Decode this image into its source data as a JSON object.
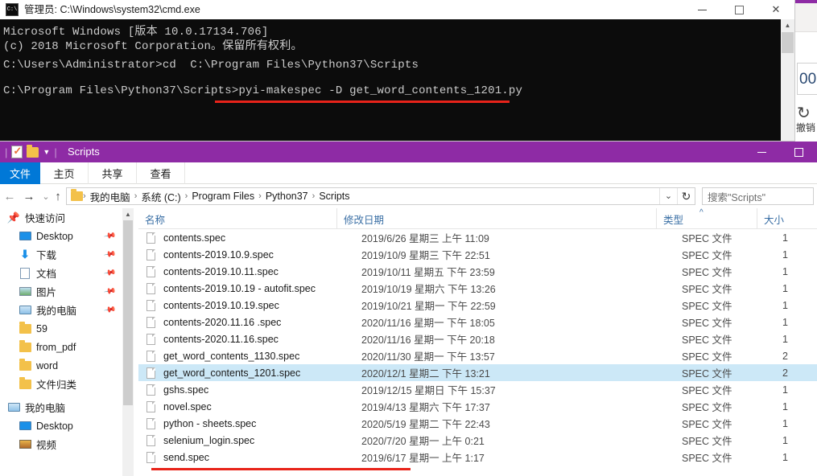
{
  "background_app": {
    "cell_value": "00",
    "undo_label": "撤销",
    "undo_icon": "undo-arrow-icon"
  },
  "cmd_window": {
    "icon": "console-icon",
    "title": "管理员: C:\\Windows\\system32\\cmd.exe",
    "buttons": {
      "minimize": "minimize-icon",
      "maximize": "maximize-icon",
      "close": "✕"
    },
    "lines": [
      "Microsoft Windows [版本 10.0.17134.706]",
      "(c) 2018 Microsoft Corporation。保留所有权利。",
      "",
      "C:\\Users\\Administrator>cd  C:\\Program Files\\Python37\\Scripts",
      "",
      "C:\\Program Files\\Python37\\Scripts>pyi-makespec -D get_word_contents_1201.py"
    ],
    "highlight_color": "#e8231a"
  },
  "explorer": {
    "accent_color": "#8e2ba5",
    "title": "Scripts",
    "quick_access_toolbar": [
      {
        "name": "properties-icon"
      },
      {
        "name": "new-folder-icon"
      },
      {
        "name": "customize-qat-caret-icon"
      }
    ],
    "window_buttons": {
      "minimize": "minimize-icon",
      "maximize": "maximize-icon"
    },
    "ribbon": {
      "file_tab": "文件",
      "tabs": [
        {
          "label": "主页"
        },
        {
          "label": "共享"
        },
        {
          "label": "查看"
        }
      ]
    },
    "navigation": {
      "back_icon": "back-arrow-icon",
      "forward_icon": "forward-arrow-icon",
      "recent_icon": "recent-locations-chevron-icon",
      "up_icon": "up-arrow-icon",
      "breadcrumbs": [
        "我的电脑",
        "系统 (C:)",
        "Program Files",
        "Python37",
        "Scripts"
      ],
      "dropdown_icon": "chevron-down-icon",
      "refresh_icon": "refresh-icon"
    },
    "search": {
      "placeholder": "搜索\"Scripts\"",
      "value": ""
    },
    "sidebar": {
      "groups": [
        {
          "header": {
            "label": "快速访问",
            "icon": "pin-star-icon"
          },
          "items": [
            {
              "label": "Desktop",
              "icon": "monitor-icon",
              "pinned": true
            },
            {
              "label": "下载",
              "icon": "download-arrow-icon",
              "pinned": true
            },
            {
              "label": "文档",
              "icon": "document-icon",
              "pinned": true
            },
            {
              "label": "图片",
              "icon": "picture-icon",
              "pinned": true
            },
            {
              "label": "我的电脑",
              "icon": "computer-icon",
              "pinned": true
            },
            {
              "label": "59",
              "icon": "folder-icon",
              "pinned": false
            },
            {
              "label": "from_pdf",
              "icon": "folder-icon",
              "pinned": false
            },
            {
              "label": "word",
              "icon": "folder-icon",
              "pinned": false
            },
            {
              "label": "文件归类",
              "icon": "folder-icon",
              "pinned": false
            }
          ]
        },
        {
          "header": {
            "label": "我的电脑",
            "icon": "computer-icon"
          },
          "items": [
            {
              "label": "Desktop",
              "icon": "monitor-icon",
              "pinned": false
            },
            {
              "label": "视频",
              "icon": "video-icon",
              "pinned": false
            }
          ]
        }
      ]
    },
    "filelist": {
      "columns": [
        {
          "label": "名称",
          "sorted": false
        },
        {
          "label": "修改日期",
          "sorted": false
        },
        {
          "label": "类型",
          "sorted": true,
          "sort_indicator": "^"
        },
        {
          "label": "大小",
          "sorted": false
        }
      ],
      "rows": [
        {
          "name": "contents.spec",
          "date": "2019/6/26 星期三 上午 11:09",
          "type": "SPEC 文件",
          "size": "1",
          "selected": false
        },
        {
          "name": "contents-2019.10.9.spec",
          "date": "2019/10/9 星期三 下午 22:51",
          "type": "SPEC 文件",
          "size": "1",
          "selected": false
        },
        {
          "name": "contents-2019.10.11.spec",
          "date": "2019/10/11 星期五 下午 23:59",
          "type": "SPEC 文件",
          "size": "1",
          "selected": false
        },
        {
          "name": "contents-2019.10.19 - autofit.spec",
          "date": "2019/10/19 星期六 下午 13:26",
          "type": "SPEC 文件",
          "size": "1",
          "selected": false
        },
        {
          "name": "contents-2019.10.19.spec",
          "date": "2019/10/21 星期一 下午 22:59",
          "type": "SPEC 文件",
          "size": "1",
          "selected": false
        },
        {
          "name": "contents-2020.11.16 .spec",
          "date": "2020/11/16 星期一 下午 18:05",
          "type": "SPEC 文件",
          "size": "1",
          "selected": false
        },
        {
          "name": "contents-2020.11.16.spec",
          "date": "2020/11/16 星期一 下午 20:18",
          "type": "SPEC 文件",
          "size": "1",
          "selected": false
        },
        {
          "name": "get_word_contents_1130.spec",
          "date": "2020/11/30 星期一 下午 13:57",
          "type": "SPEC 文件",
          "size": "2",
          "selected": false
        },
        {
          "name": "get_word_contents_1201.spec",
          "date": "2020/12/1 星期二 下午 13:21",
          "type": "SPEC 文件",
          "size": "2",
          "selected": true
        },
        {
          "name": "gshs.spec",
          "date": "2019/12/15 星期日 下午 15:37",
          "type": "SPEC 文件",
          "size": "1",
          "selected": false
        },
        {
          "name": "novel.spec",
          "date": "2019/4/13 星期六 下午 17:37",
          "type": "SPEC 文件",
          "size": "1",
          "selected": false
        },
        {
          "name": "python - sheets.spec",
          "date": "2020/5/19 星期二 下午 22:43",
          "type": "SPEC 文件",
          "size": "1",
          "selected": false
        },
        {
          "name": "selenium_login.spec",
          "date": "2020/7/20 星期一 上午 0:21",
          "type": "SPEC 文件",
          "size": "1",
          "selected": false
        },
        {
          "name": "send.spec",
          "date": "2019/6/17 星期一 上午 1:17",
          "type": "SPEC 文件",
          "size": "1",
          "selected": false
        }
      ]
    }
  }
}
